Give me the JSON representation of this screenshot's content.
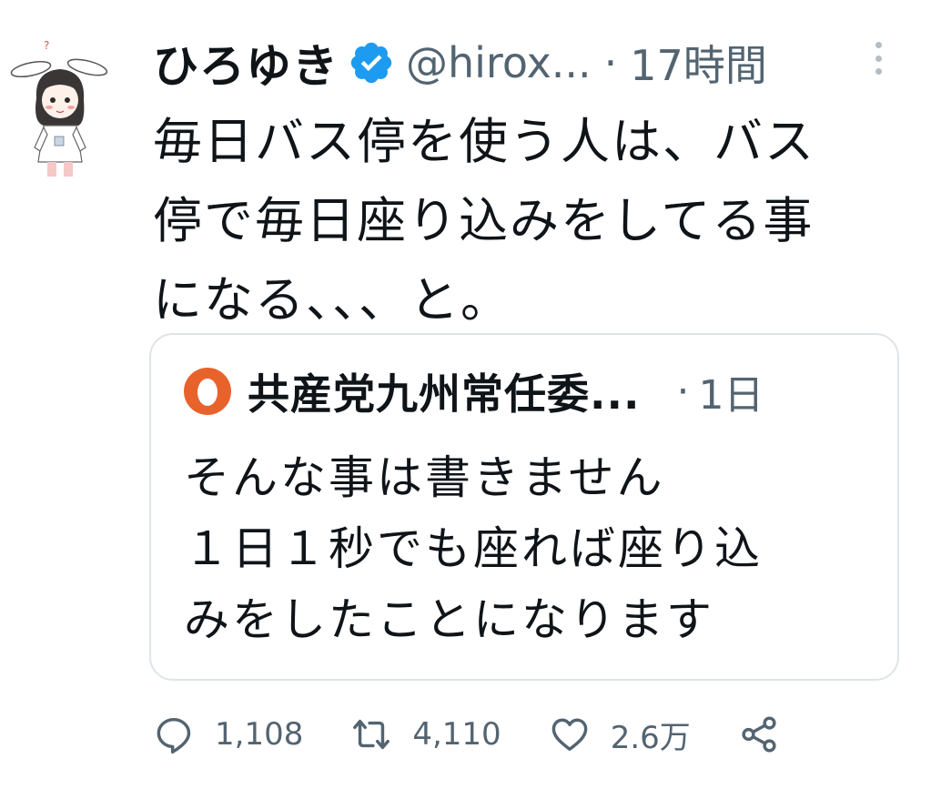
{
  "tweet": {
    "author_name": "ひろゆき",
    "handle": "@hirox...",
    "separator": "·",
    "time": "17時間",
    "text_lines": [
      "毎日バス停を使う人は、バス",
      "停で毎日座り込みをしてる事",
      "になる、、、と。"
    ],
    "avatar_icon": "rabbit-ear-character-avatar",
    "verified_color": "#1d9bf0"
  },
  "quote": {
    "author_name": "共産党九州常任委...",
    "separator": "·",
    "time": "1日",
    "avatar_color": "#e8632b",
    "text_lines": [
      "そんな事は書きません",
      "１日１秒でも座れば座り込",
      "みをしたことになります"
    ]
  },
  "actions": {
    "reply_count": "1,108",
    "retweet_count": "4,110",
    "like_count": "2.6万",
    "icon_color": "#536471"
  }
}
